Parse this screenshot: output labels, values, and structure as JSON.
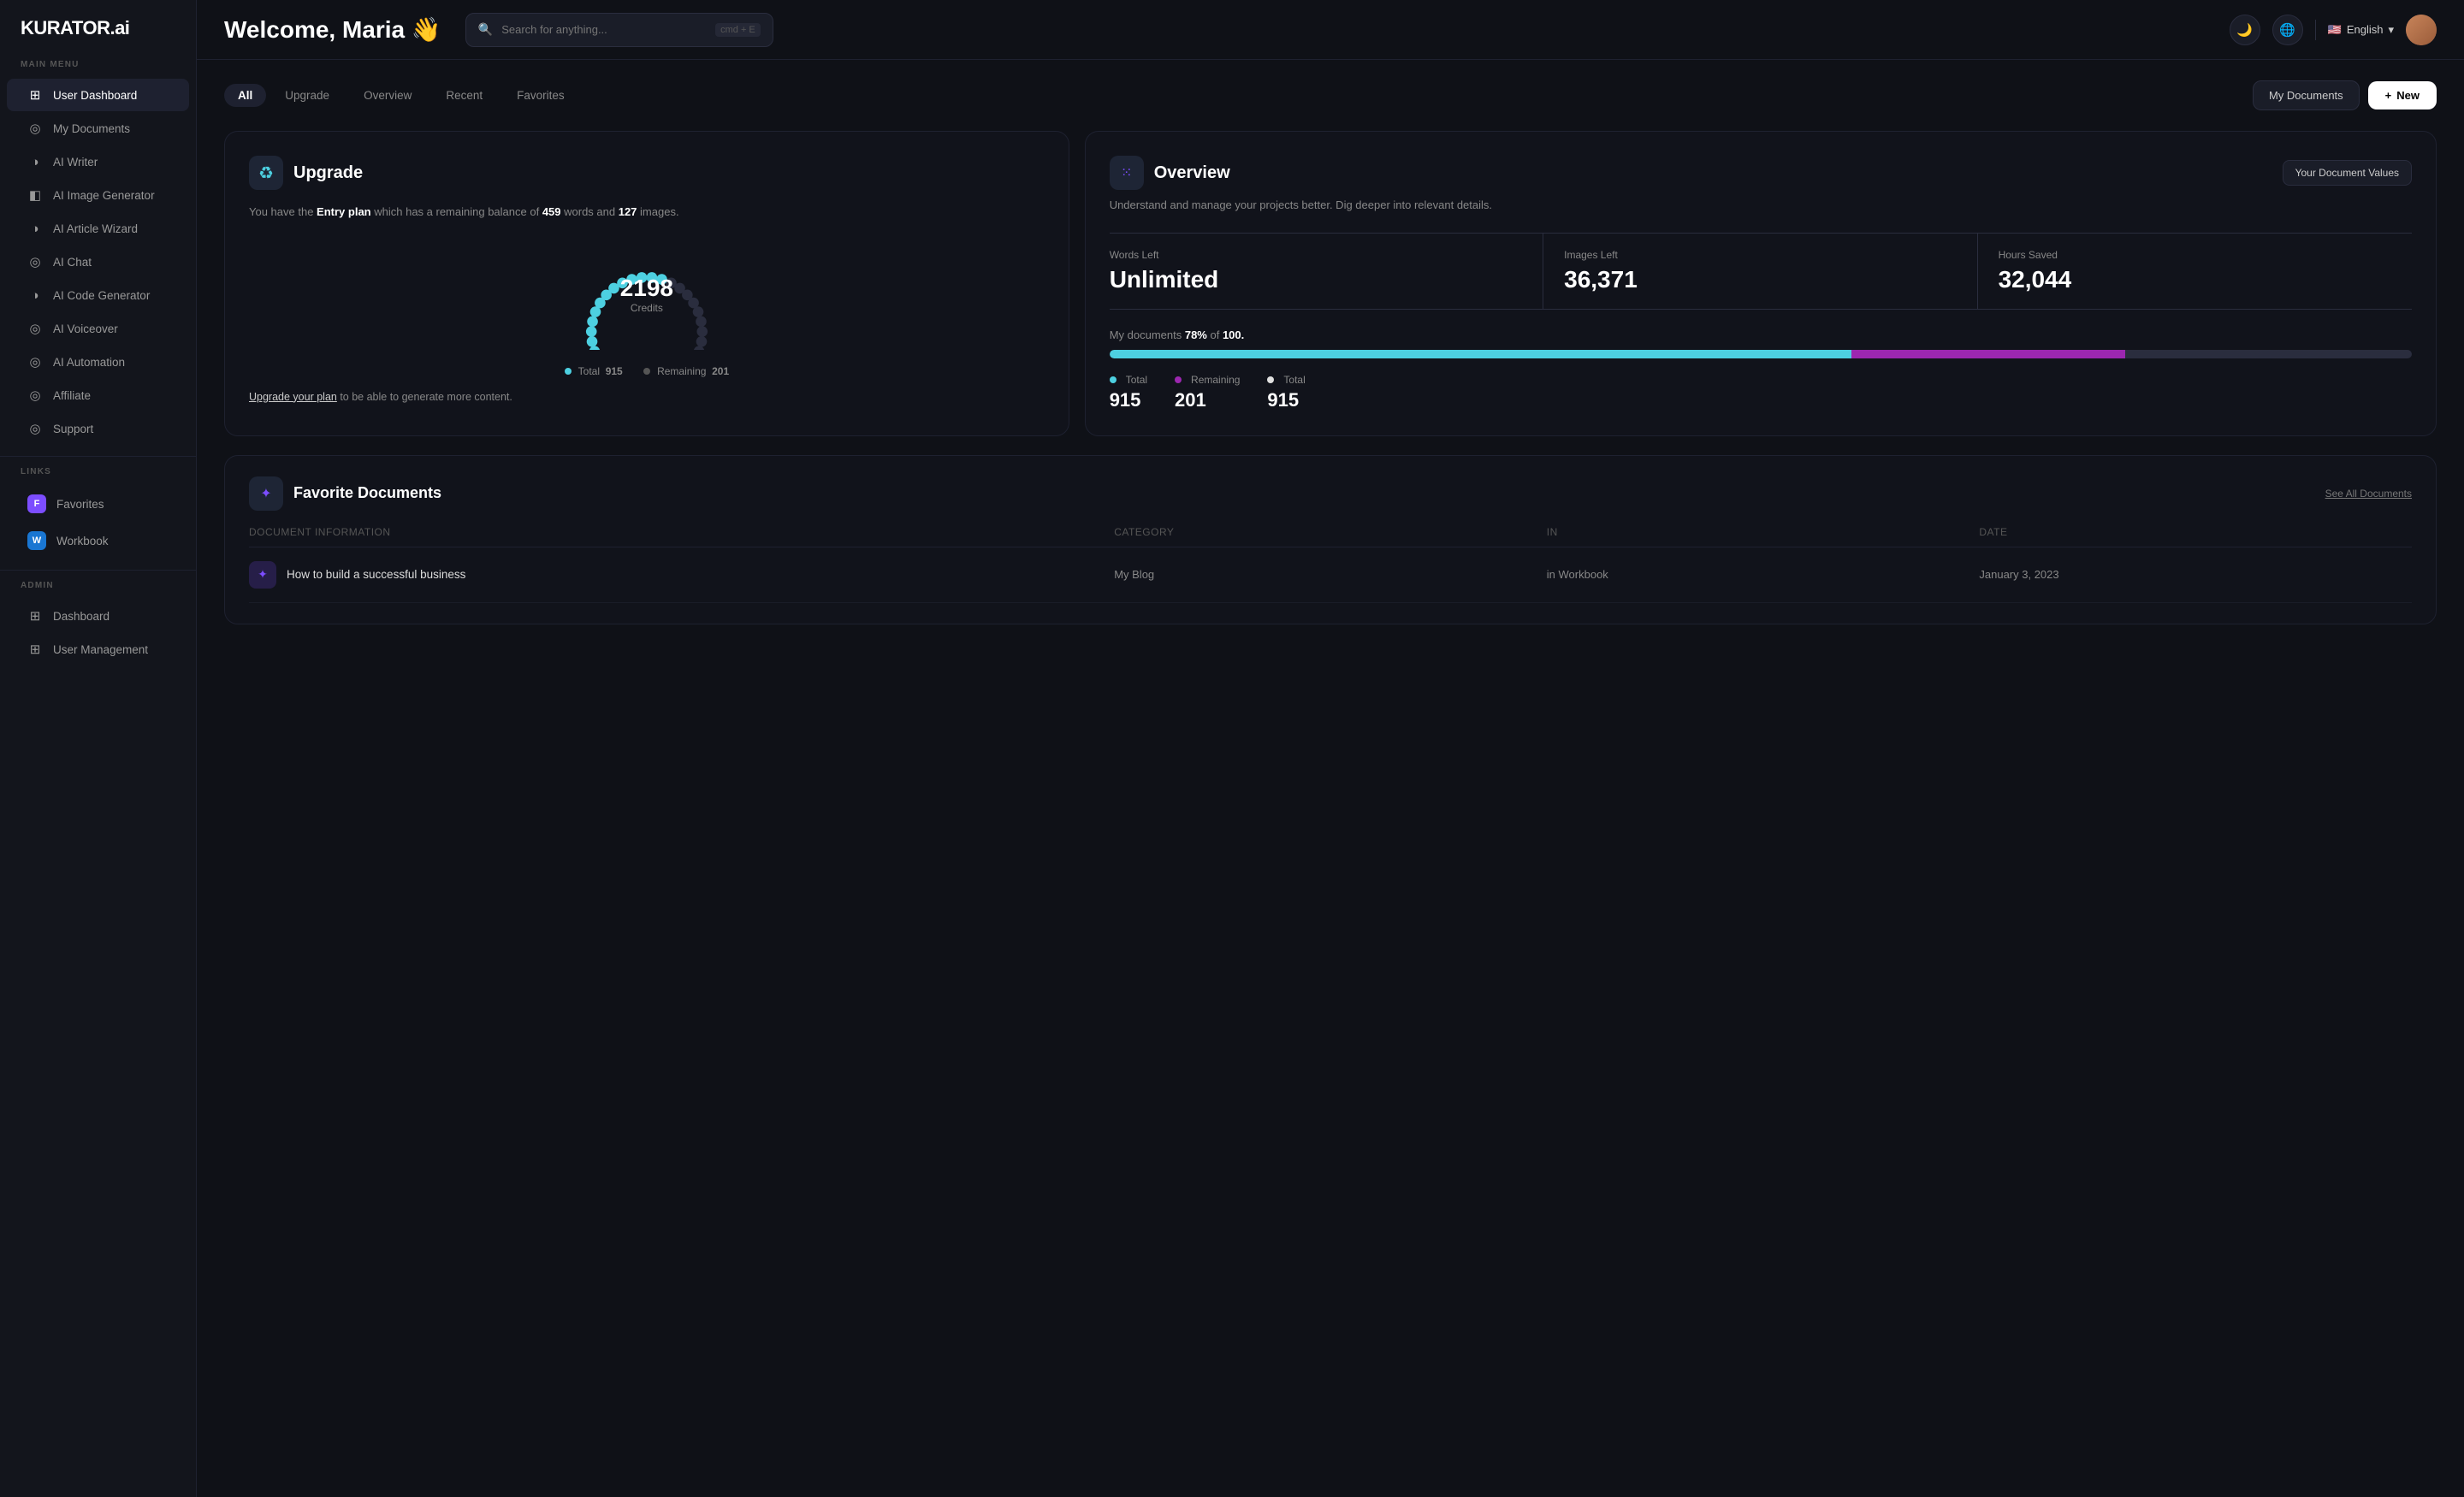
{
  "logo": "KURATOR.ai",
  "sidebar": {
    "main_menu_label": "MAIN MENU",
    "items": [
      {
        "id": "user-dashboard",
        "label": "User Dashboard",
        "icon": "⊞",
        "active": true
      },
      {
        "id": "my-documents",
        "label": "My Documents",
        "icon": "◎"
      },
      {
        "id": "ai-writer",
        "label": "AI Writer",
        "icon": "◑"
      },
      {
        "id": "ai-image-generator",
        "label": "AI Image Generator",
        "icon": "◧"
      },
      {
        "id": "ai-article-wizard",
        "label": "AI Article Wizard",
        "icon": "◑"
      },
      {
        "id": "ai-chat",
        "label": "AI Chat",
        "icon": "◎"
      },
      {
        "id": "ai-code-generator",
        "label": "AI Code Generator",
        "icon": "◑"
      },
      {
        "id": "ai-voiceover",
        "label": "AI Voiceover",
        "icon": "◎"
      },
      {
        "id": "ai-automation",
        "label": "AI Automation",
        "icon": "◎"
      },
      {
        "id": "affiliate",
        "label": "Affiliate",
        "icon": "◎"
      },
      {
        "id": "support",
        "label": "Support",
        "icon": "◎"
      }
    ],
    "links_label": "LINKS",
    "links": [
      {
        "id": "favorites",
        "label": "Favorites",
        "badge": "F",
        "badge_class": "badge-f"
      },
      {
        "id": "workbook",
        "label": "Workbook",
        "badge": "W",
        "badge_class": "badge-w"
      }
    ],
    "admin_label": "ADMIN",
    "admin_items": [
      {
        "id": "dashboard",
        "label": "Dashboard"
      },
      {
        "id": "user-management",
        "label": "User Management"
      }
    ]
  },
  "topbar": {
    "greeting": "Welcome, Maria 👋",
    "search_placeholder": "Search for anything...",
    "search_shortcut": "cmd + E",
    "language_flag": "🇺🇸",
    "language": "English"
  },
  "filter_tabs": {
    "tabs": [
      {
        "id": "all",
        "label": "All",
        "active": true
      },
      {
        "id": "upgrade",
        "label": "Upgrade"
      },
      {
        "id": "overview",
        "label": "Overview"
      },
      {
        "id": "recent",
        "label": "Recent"
      },
      {
        "id": "favorites",
        "label": "Favorites"
      }
    ],
    "my_documents_btn": "My Documents",
    "new_btn": "New"
  },
  "upgrade_card": {
    "title": "Upgrade",
    "icon": "♻",
    "plan_text_1": "You have the ",
    "plan_name": "Entry plan",
    "plan_text_2": " which has a remaining balance of ",
    "words_count": "459",
    "plan_text_3": " words and ",
    "images_count": "127",
    "plan_text_4": " images.",
    "credits_number": "2198",
    "credits_label": "Credits",
    "total_label": "Total",
    "total_value": "915",
    "remaining_label": "Remaining",
    "remaining_value": "201",
    "upgrade_link_text": "Upgrade your plan",
    "upgrade_suffix": " to be able to generate more content."
  },
  "overview_card": {
    "title": "Overview",
    "icon": "⁙",
    "doc_values_btn": "Your Document Values",
    "description": "Understand and manage your projects better. Dig deeper into relevant details.",
    "stats": [
      {
        "label": "Words Left",
        "value": "Unlimited"
      },
      {
        "label": "Images Left",
        "value": "36,371"
      },
      {
        "label": "Hours Saved",
        "value": "32,044"
      }
    ],
    "docs_progress_text": "My documents ",
    "docs_progress_pct": "78%",
    "docs_progress_mid": " of ",
    "docs_progress_total": "100.",
    "progress_teal_pct": 57,
    "progress_purple_pct": 21,
    "legend": [
      {
        "label": "Total",
        "value": "915",
        "dot": "dot-teal"
      },
      {
        "label": "Remaining",
        "value": "201",
        "dot": "dot-purple"
      },
      {
        "label": "Total",
        "value": "915",
        "dot": "dot-white"
      }
    ]
  },
  "favorite_documents": {
    "title": "Favorite Documents",
    "icon": "✦",
    "see_all_label": "See All Documents",
    "columns": [
      "Document Information",
      "Category",
      "In",
      "Date"
    ],
    "rows": [
      {
        "name": "How to build a successful business",
        "icon": "✦",
        "category": "My Blog",
        "location": "in Workbook",
        "date": "January 3, 2023"
      }
    ]
  }
}
